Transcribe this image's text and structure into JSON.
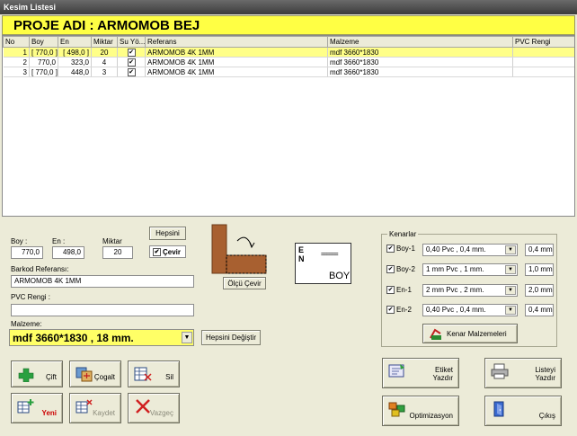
{
  "window": {
    "title": "Kesim Listesi"
  },
  "project": {
    "title": "PROJE ADI : ARMOMOB BEJ"
  },
  "table": {
    "columns": [
      "No",
      "Boy",
      "En",
      "Miktar",
      "Su Yö...",
      "Referans",
      "Malzeme",
      "PVC Rengi"
    ],
    "rows": [
      {
        "no": "1",
        "boy": "[ 770,0 ]",
        "en": "[ 498,0 ]",
        "miktar": "20",
        "suyo": true,
        "referans": "ARMOMOB 4K 1MM",
        "malzeme": "mdf 3660*1830",
        "pvc": ""
      },
      {
        "no": "2",
        "boy": "770,0",
        "en": "323,0",
        "miktar": "4",
        "suyo": true,
        "referans": "ARMOMOB 4K 1MM",
        "malzeme": "mdf 3660*1830",
        "pvc": ""
      },
      {
        "no": "3",
        "boy": "[ 770,0 ]",
        "en": "448,0",
        "miktar": "3",
        "suyo": true,
        "referans": "ARMOMOB 4K 1MM",
        "malzeme": "mdf 3660*1830",
        "pvc": ""
      }
    ]
  },
  "form": {
    "boy_label": "Boy :",
    "boy_value": "770,0",
    "en_label": "En :",
    "en_value": "498,0",
    "miktar_label": "Miktar",
    "miktar_value": "20",
    "hepsini_label": "Hepsini",
    "cevir_label": "Çevir",
    "olcu_cevir_label": "Ölçü Çevir",
    "barkod_label": "Barkod Referansı:",
    "barkod_value": "ARMOMOB 4K 1MM",
    "pvc_label": "PVC Rengi :",
    "pvc_value": "",
    "malzeme_label": "Malzeme:",
    "malzeme_value": "mdf 3660*1830 , 18 mm.",
    "hepsini_degistir_label": "Hepsini Değiştir"
  },
  "orient_box": {
    "en": "E N",
    "dashes": "======",
    "boy": "BOY"
  },
  "kenarlar": {
    "title": "Kenarlar",
    "rows": [
      {
        "label": "Boy-1",
        "checked": true,
        "value": "0,40 Pvc , 0,4 mm.",
        "thickness": "0,4 mm"
      },
      {
        "label": "Boy-2",
        "checked": true,
        "value": "1 mm Pvc , 1 mm.",
        "thickness": "1,0 mm"
      },
      {
        "label": "En-1",
        "checked": true,
        "value": "2 mm Pvc , 2 mm.",
        "thickness": "2,0 mm"
      },
      {
        "label": "En-2",
        "checked": true,
        "value": "0,40 Pvc , 0,4 mm.",
        "thickness": "0,4 mm"
      }
    ],
    "button": "Kenar Malzemeleri"
  },
  "buttons": {
    "cift": "Çift",
    "cogalt": "Çogalt",
    "sil": "Sil",
    "yeni": "Yeni",
    "kaydet": "Kaydet",
    "vazgec": "Vazgeç",
    "etiket1": "Etiket",
    "etiket2": "Yazdır",
    "liste1": "Listeyi",
    "liste2": "Yazdır",
    "optimizasyon": "Optimizasyon",
    "cikis": "Çıkış"
  },
  "colors": {
    "highlight": "#ffff44",
    "background": "#ecebd8",
    "yeni_text": "#cc0000"
  }
}
